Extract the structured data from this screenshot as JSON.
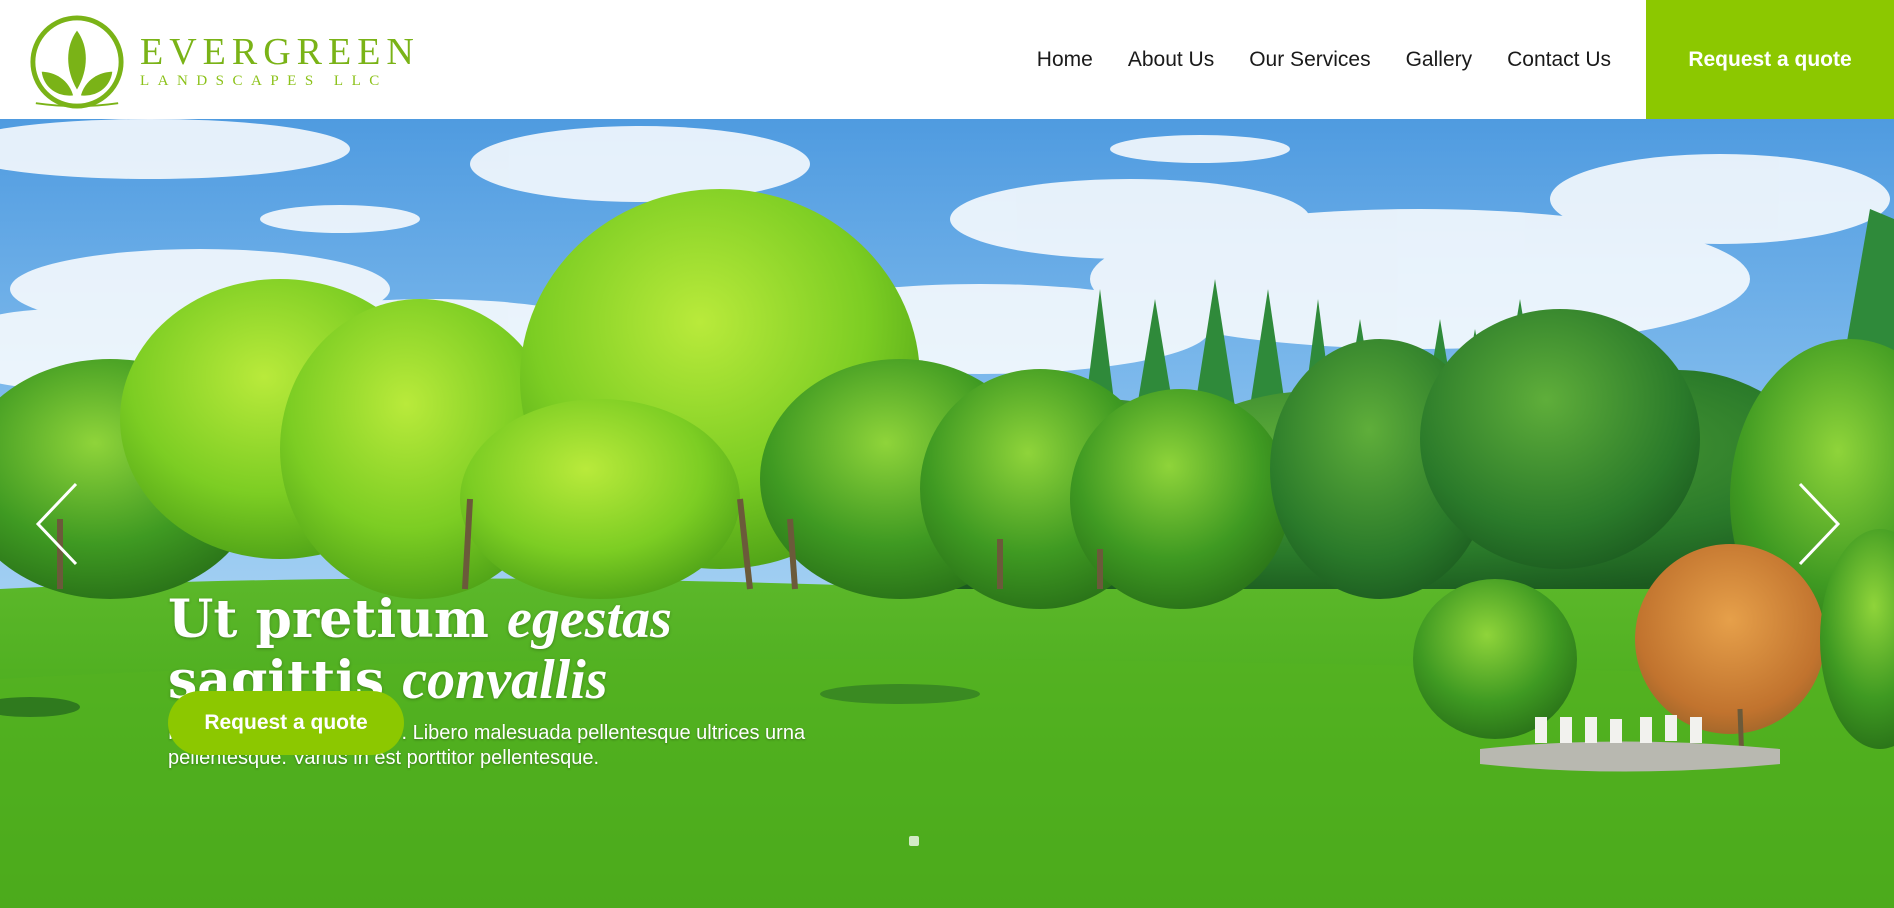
{
  "brand": {
    "name": "EVERGREEN",
    "subtitle": "LANDSCAPES LLC",
    "primary_color": "#8cc800",
    "logo_color": "#7ab317"
  },
  "nav": {
    "items": [
      {
        "label": "Home"
      },
      {
        "label": "About Us"
      },
      {
        "label": "Our Services"
      },
      {
        "label": "Gallery"
      },
      {
        "label": "Contact Us"
      }
    ],
    "cta_label": "Request a quote"
  },
  "hero": {
    "title_line1_plain": "Ut pretium ",
    "title_line1_italic": "egestas",
    "title_line2_plain": "sagittis ",
    "title_line2_italic": "convallis",
    "text": "Platea neque amet a dolor. Libero malesuada pellentesque ultrices urna pellentesque. Varius in est porttitor pellentesque.",
    "cta_label": "Request a quote",
    "prev_icon": "chevron-left-icon",
    "next_icon": "chevron-right-icon",
    "background": "park landscape with trees, lawn and blue sky"
  }
}
